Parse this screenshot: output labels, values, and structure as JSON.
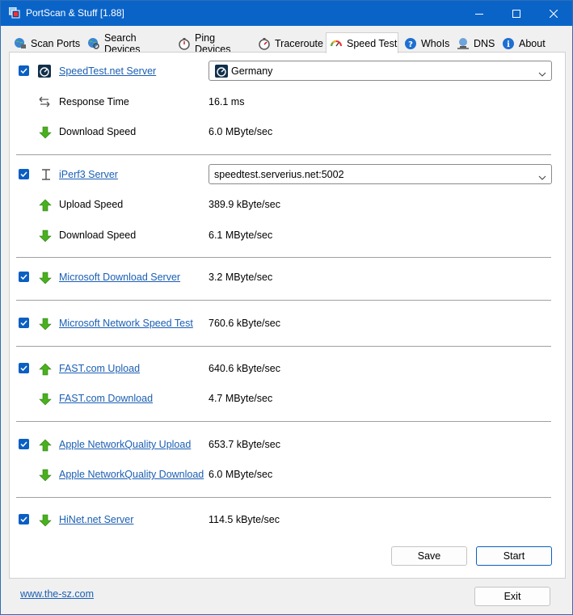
{
  "window": {
    "title": "PortScan & Stuff [1.88]"
  },
  "tabs": [
    {
      "label": "Scan Ports",
      "icon": "globe-network-icon"
    },
    {
      "label": "Search Devices",
      "icon": "globe-search-icon"
    },
    {
      "label": "Ping Devices",
      "icon": "stopwatch-icon"
    },
    {
      "label": "Traceroute",
      "icon": "stopwatch-route-icon"
    },
    {
      "label": "Speed Test",
      "icon": "speedometer-icon",
      "active": true
    },
    {
      "label": "WhoIs",
      "icon": "help-icon"
    },
    {
      "label": "DNS",
      "icon": "network-computer-icon"
    },
    {
      "label": "About",
      "icon": "info-icon"
    }
  ],
  "speedtest_net": {
    "label": "SpeedTest.net Server",
    "server_selected": "Germany",
    "response_time_label": "Response Time",
    "response_time_value": "16.1 ms",
    "download_label": "Download Speed",
    "download_value": "6.0 MByte/sec"
  },
  "iperf3": {
    "label": "iPerf3 Server",
    "server_value": "speedtest.serverius.net:5002",
    "upload_label": "Upload Speed",
    "upload_value": "389.9 kByte/sec",
    "download_label": "Download Speed",
    "download_value": "6.1 MByte/sec"
  },
  "microsoft_download": {
    "label": "Microsoft Download Server",
    "value": "3.2 MByte/sec"
  },
  "microsoft_network": {
    "label": "Microsoft Network Speed Test",
    "value": "760.6 kByte/sec"
  },
  "fast_com": {
    "upload_label": "FAST.com Upload",
    "upload_value": "640.6 kByte/sec",
    "download_label": "FAST.com Download",
    "download_value": "4.7 MByte/sec"
  },
  "apple": {
    "upload_label": "Apple NetworkQuality Upload",
    "upload_value": "653.7 kByte/sec",
    "download_label": "Apple NetworkQuality Download",
    "download_value": "6.0 MByte/sec"
  },
  "hinet": {
    "label": "HiNet.net Server",
    "value": "114.5 kByte/sec"
  },
  "buttons": {
    "save": "Save",
    "start": "Start",
    "exit": "Exit"
  },
  "footer": {
    "link": "www.the-sz.com"
  },
  "colors": {
    "titlebar": "#0a64c8",
    "accent": "#0a5fc2",
    "link": "#1b5fb3",
    "arrow_green": "#49b01e"
  }
}
